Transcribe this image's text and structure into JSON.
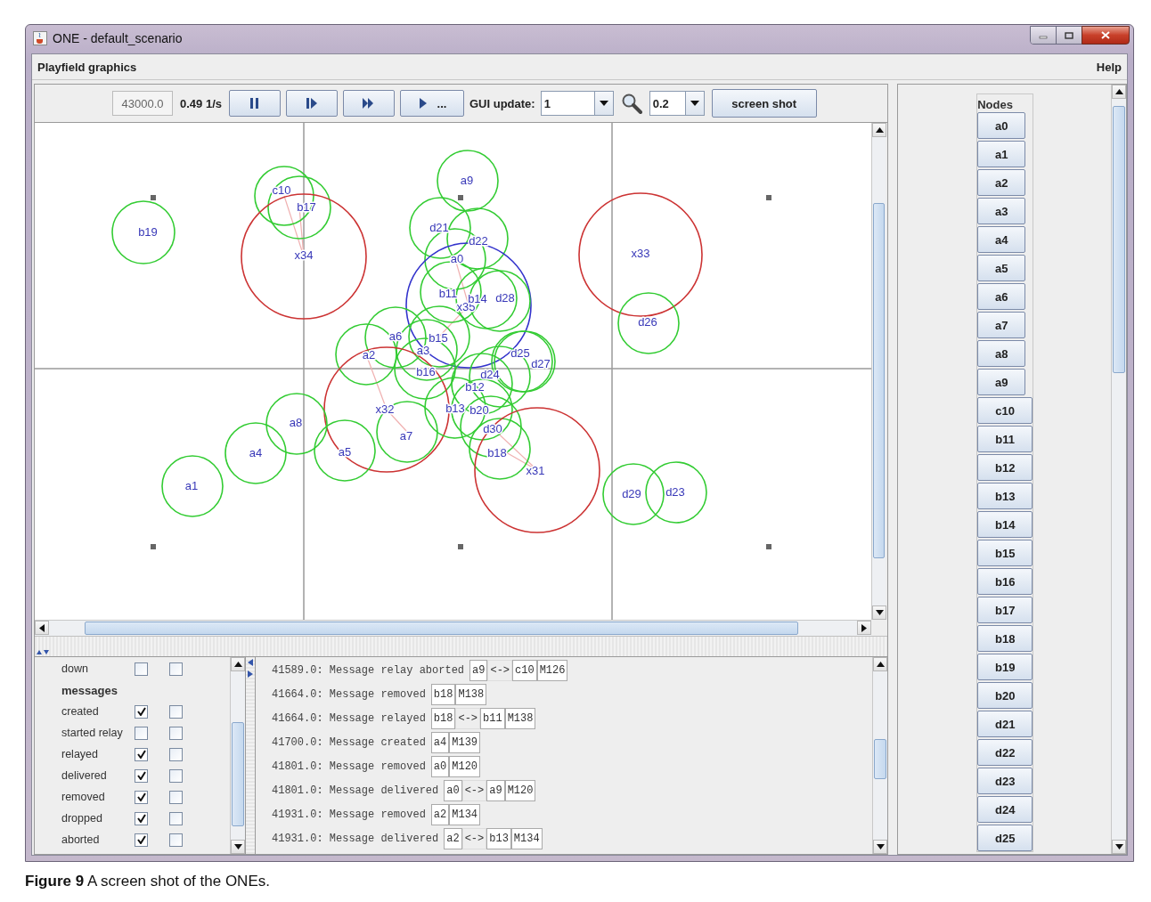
{
  "window": {
    "title": "ONE - default_scenario"
  },
  "menu": [
    {
      "label": "Playfield graphics"
    },
    {
      "label": "Help"
    }
  ],
  "toolbar": {
    "sim_time": "43000.0",
    "speed": "0.49 1/s",
    "buttons": [
      {
        "kind": "pause"
      },
      {
        "kind": "step"
      },
      {
        "kind": "fast_forward"
      },
      {
        "kind": "play_until",
        "label": "..."
      }
    ],
    "gui_update_label": "GUI update:",
    "gui_update": "1",
    "zoom": "0.2",
    "screenshot": "screen shot"
  },
  "playfield": {
    "nodes": [
      {
        "label": "b19",
        "color": "#33cc33"
      },
      {
        "label": "c10",
        "color": "#33cc33"
      },
      {
        "label": "b17",
        "color": "#33cc33"
      },
      {
        "label": "x34",
        "color": "#cc3333"
      },
      {
        "label": "a9",
        "color": "#33cc33"
      },
      {
        "label": "d21",
        "color": "#33cc33"
      },
      {
        "label": "d22",
        "color": "#33cc33"
      },
      {
        "label": "a0",
        "color": "#33cc33"
      },
      {
        "label": "b11",
        "color": "#33cc33"
      },
      {
        "label": "x35",
        "color": "#3333cc"
      },
      {
        "label": "b14",
        "color": "#33cc33"
      },
      {
        "label": "d28",
        "color": "#33cc33"
      },
      {
        "label": "a6",
        "color": "#33cc33"
      },
      {
        "label": "b15",
        "color": "#33cc33"
      },
      {
        "label": "a2",
        "color": "#33cc33"
      },
      {
        "label": "a3",
        "color": "#33cc33"
      },
      {
        "label": "b16",
        "color": "#33cc33"
      },
      {
        "label": "d25",
        "color": "#33cc33"
      },
      {
        "label": "d27",
        "color": "#33cc33"
      },
      {
        "label": "d24",
        "color": "#33cc33"
      },
      {
        "label": "b12",
        "color": "#33cc33"
      },
      {
        "label": "x32",
        "color": "#cc3333"
      },
      {
        "label": "b13",
        "color": "#33cc33"
      },
      {
        "label": "b20",
        "color": "#33cc33"
      },
      {
        "label": "d30",
        "color": "#33cc33"
      },
      {
        "label": "b18",
        "color": "#33cc33"
      },
      {
        "label": "x31",
        "color": "#cc3333"
      },
      {
        "label": "a7",
        "color": "#33cc33"
      },
      {
        "label": "a8",
        "color": "#33cc33"
      },
      {
        "label": "a4",
        "color": "#33cc33"
      },
      {
        "label": "a5",
        "color": "#33cc33"
      },
      {
        "label": "a1",
        "color": "#33cc33"
      },
      {
        "label": "x33",
        "color": "#cc3333"
      },
      {
        "label": "d26",
        "color": "#33cc33"
      },
      {
        "label": "d29",
        "color": "#33cc33"
      },
      {
        "label": "d23",
        "color": "#33cc33"
      }
    ]
  },
  "event_filters": {
    "rows": [
      {
        "kind": "option",
        "label": "down",
        "show": false,
        "pause": false
      },
      {
        "kind": "header",
        "label": "messages"
      },
      {
        "kind": "option",
        "label": "created",
        "show": true,
        "pause": false
      },
      {
        "kind": "option",
        "label": "started relay",
        "show": false,
        "pause": false
      },
      {
        "kind": "option",
        "label": "relayed",
        "show": true,
        "pause": false
      },
      {
        "kind": "option",
        "label": "delivered",
        "show": true,
        "pause": false
      },
      {
        "kind": "option",
        "label": "removed",
        "show": true,
        "pause": false
      },
      {
        "kind": "option",
        "label": "dropped",
        "show": true,
        "pause": false
      },
      {
        "kind": "option",
        "label": "aborted",
        "show": true,
        "pause": false
      }
    ]
  },
  "event_log": {
    "entries": [
      {
        "text": "41589.0: Message relay aborted",
        "parts": [
          {
            "kind": "node",
            "label": "a9"
          },
          {
            "kind": "link",
            "label": "<->"
          },
          {
            "kind": "node",
            "label": "c10"
          },
          {
            "kind": "message",
            "label": "M126"
          }
        ]
      },
      {
        "text": "41664.0: Message removed",
        "parts": [
          {
            "kind": "node",
            "label": "b18"
          },
          {
            "kind": "message",
            "label": "M138"
          }
        ]
      },
      {
        "text": "41664.0: Message relayed",
        "parts": [
          {
            "kind": "node",
            "label": "b18"
          },
          {
            "kind": "link",
            "label": "<->"
          },
          {
            "kind": "node",
            "label": "b11"
          },
          {
            "kind": "message",
            "label": "M138"
          }
        ]
      },
      {
        "text": "41700.0: Message created",
        "parts": [
          {
            "kind": "node",
            "label": "a4"
          },
          {
            "kind": "message",
            "label": "M139"
          }
        ]
      },
      {
        "text": "41801.0: Message removed",
        "parts": [
          {
            "kind": "node",
            "label": "a0"
          },
          {
            "kind": "message",
            "label": "M120"
          }
        ]
      },
      {
        "text": "41801.0: Message delivered",
        "parts": [
          {
            "kind": "node",
            "label": "a0"
          },
          {
            "kind": "link",
            "label": "<->"
          },
          {
            "kind": "node",
            "label": "a9"
          },
          {
            "kind": "message",
            "label": "M120"
          }
        ]
      },
      {
        "text": "41931.0: Message removed",
        "parts": [
          {
            "kind": "node",
            "label": "a2"
          },
          {
            "kind": "message",
            "label": "M134"
          }
        ]
      },
      {
        "text": "41931.0: Message delivered",
        "parts": [
          {
            "kind": "node",
            "label": "a2"
          },
          {
            "kind": "link",
            "label": "<->"
          },
          {
            "kind": "node",
            "label": "b13"
          },
          {
            "kind": "message",
            "label": "M134"
          }
        ]
      }
    ]
  },
  "nodes_panel": {
    "title": "Nodes",
    "nodes": [
      "a0",
      "a1",
      "a2",
      "a3",
      "a4",
      "a5",
      "a6",
      "a7",
      "a8",
      "a9",
      "c10",
      "b11",
      "b12",
      "b13",
      "b14",
      "b15",
      "b16",
      "b17",
      "b18",
      "b19",
      "b20",
      "d21",
      "d22",
      "d23",
      "d24",
      "d25"
    ]
  },
  "caption": "**Figure 9** A screen shot of the ONEs."
}
